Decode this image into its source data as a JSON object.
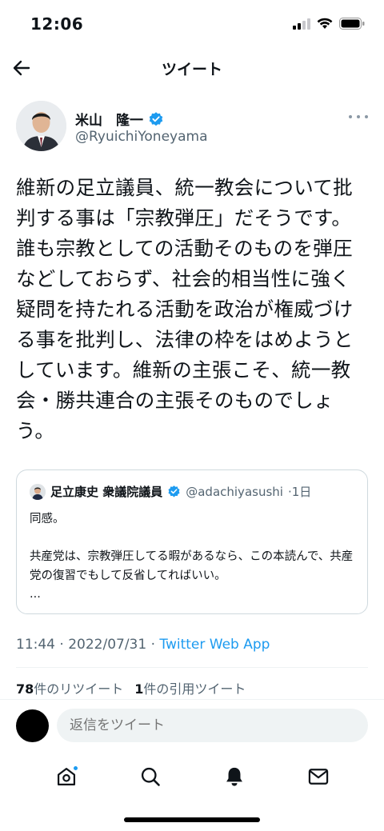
{
  "status_bar": {
    "time": "12:06"
  },
  "nav": {
    "title": "ツイート"
  },
  "author": {
    "name": "米山　隆一",
    "handle": "@RyuichiYoneyama"
  },
  "tweet": {
    "text": "維新の足立議員、統一教会について批判する事は「宗教弾圧」だそうです。誰も宗教としての活動そのものを弾圧などしておらず、社会的相当性に強く疑問を持たれる活動を政治が権威づける事を批判し、法律の枠をはめようとしています。維新の主張こそ、統一教会・勝共連合の主張そのものでしょう。"
  },
  "quoted_tweet": {
    "name": "足立康史 衆議院議員",
    "handle": "@adachiyasushi",
    "time": "·1日",
    "text": "同感。\n\n共産党は、宗教弾圧してる暇があるなら、この本読んで、共産党の復習でもして反省してればいい。\n..."
  },
  "meta": {
    "time": "11:44 · 2022/07/31 · ",
    "source": "Twitter Web App"
  },
  "stats": {
    "retweets_count": "78",
    "retweets_label": "件のリツイート",
    "quotes_count": "1",
    "quotes_label": "件の引用ツイート"
  },
  "reply": {
    "placeholder": "返信をツイート"
  },
  "colors": {
    "accent": "#1d9bf0",
    "secondary_text": "#536471",
    "border": "#cfd9de"
  },
  "icons": [
    "back-arrow-icon",
    "verified-badge-icon",
    "more-icon",
    "home-icon",
    "search-icon",
    "notifications-bell-icon",
    "messages-envelope-icon"
  ]
}
